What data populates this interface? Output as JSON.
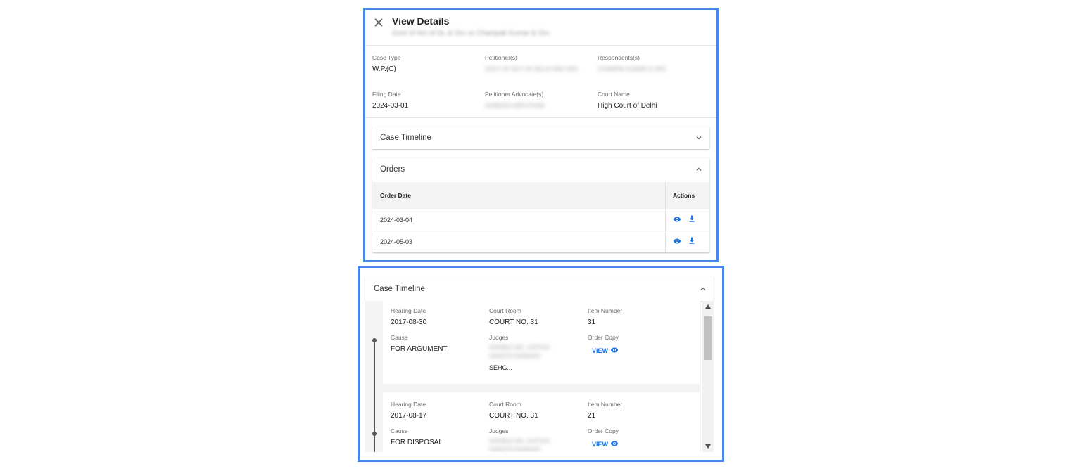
{
  "details": {
    "title": "View Details",
    "subtitle": "Govt of Nct of DL & Ors vs Champak Kumar & Ors",
    "case_type_label": "Case Type",
    "case_type_value": "W.P.(C)",
    "petitioner_label": "Petitioner(s)",
    "petitioner_value": "GOVT OF NCT OF DELHI AND ORS",
    "respondents_label": "Respondents(s)",
    "respondents_value": "CHAMPAK KUMAR & ORS",
    "filing_date_label": "Filing Date",
    "filing_date_value": "2024-03-01",
    "pet_adv_label": "Petitioner Advocate(s)",
    "pet_adv_value": "AVNEESH ARPUTHAM",
    "court_label": "Court Name",
    "court_value": "High Court of Delhi"
  },
  "case_timeline_collapsed": {
    "title": "Case Timeline"
  },
  "orders": {
    "title": "Orders",
    "col_date": "Order Date",
    "col_actions": "Actions",
    "rows": [
      {
        "date": "2024-03-04"
      },
      {
        "date": "2024-05-03"
      }
    ]
  },
  "timeline": {
    "title": "Case Timeline",
    "entries": [
      {
        "hearing_date_label": "Hearing Date",
        "hearing_date": "2017-08-30",
        "court_room_label": "Court Room",
        "court_room": "COURT NO. 31",
        "item_number_label": "Item Number",
        "item_number": "31",
        "cause_label": "Cause",
        "cause": "FOR ARGUMENT",
        "judges_label": "Judges",
        "judges_blurred": "HON'BLE MS. JUSTICE SANGITA DHINGRA",
        "judges_tail": "SEHG...",
        "order_copy_label": "Order Copy",
        "view_label": "VIEW"
      },
      {
        "hearing_date_label": "Hearing Date",
        "hearing_date": "2017-08-17",
        "court_room_label": "Court Room",
        "court_room": "COURT NO. 31",
        "item_number_label": "Item Number",
        "item_number": "21",
        "cause_label": "Cause",
        "cause": "FOR DISPOSAL",
        "judges_label": "Judges",
        "judges_blurred": "HON'BLE MS. JUSTICE SANGITA DHINGRA",
        "order_copy_label": "Order Copy",
        "view_label": "VIEW"
      }
    ]
  },
  "colors": {
    "frame": "#4a86e8",
    "accent": "#1a73e8"
  }
}
